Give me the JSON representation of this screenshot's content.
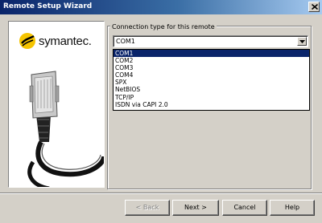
{
  "window": {
    "title": "Remote Setup Wizard"
  },
  "brand": {
    "name": "symantec."
  },
  "connection": {
    "group_label": "Connection type for this remote",
    "selected": "COM1",
    "options": [
      "COM1",
      "COM2",
      "COM3",
      "COM4",
      "SPX",
      "NetBIOS",
      "TCP/IP",
      "ISDN via CAPI 2.0"
    ]
  },
  "buttons": {
    "back": "< Back",
    "next": "Next >",
    "cancel": "Cancel",
    "help": "Help"
  },
  "colors": {
    "titlebar_start": "#0a246a",
    "titlebar_end": "#a6caf0",
    "selection": "#0a246a",
    "brand_yellow": "#f5c400"
  },
  "icons": {
    "close": "close-icon",
    "dropdown": "chevron-down-icon",
    "logo": "symantec-logo-icon",
    "illustration": "network-cable-icon"
  }
}
